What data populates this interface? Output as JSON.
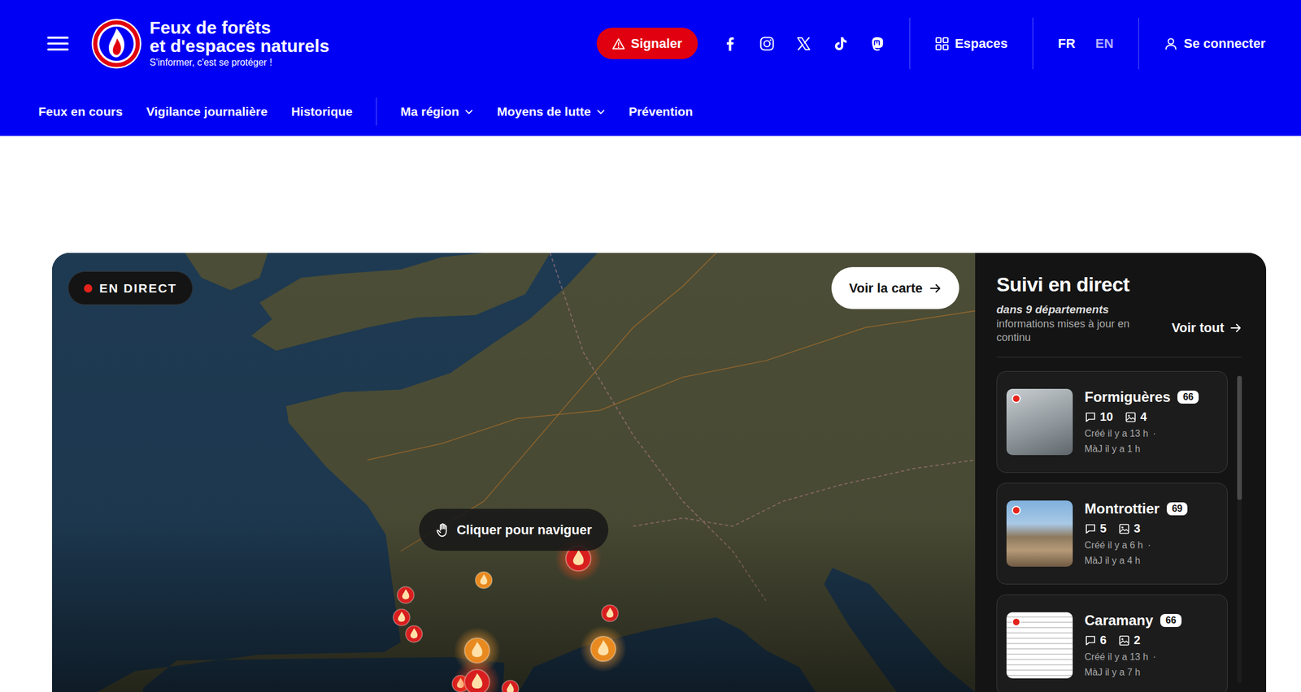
{
  "header": {
    "title_line_1": "Feux de forêts",
    "title_line_2": "et d'espaces naturels",
    "tagline": "S'informer, c'est se protéger !",
    "report_button": "Signaler",
    "spaces": "Espaces",
    "languages": [
      {
        "label": "FR",
        "selected": true
      },
      {
        "label": "EN",
        "selected": false
      }
    ],
    "login": "Se connecter"
  },
  "nav_groups": [
    [
      {
        "label": "Feux en cours",
        "dropdown": false
      },
      {
        "label": "Vigilance journalière",
        "dropdown": false
      },
      {
        "label": "Historique",
        "dropdown": false
      }
    ],
    [
      {
        "label": "Ma région",
        "dropdown": true
      },
      {
        "label": "Moyens de lutte",
        "dropdown": true
      },
      {
        "label": "Prévention",
        "dropdown": false
      }
    ]
  ],
  "map": {
    "live_badge": "EN DIRECT",
    "view_map": "Voir la carte",
    "navigate_hint": "Cliquer pour naviguer",
    "markers": [
      {
        "kind": "large",
        "color": "#d81e1e"
      },
      {
        "kind": "small",
        "color": "#e88a1f"
      },
      {
        "kind": "small",
        "color": "#d81e1e"
      },
      {
        "kind": "small",
        "color": "#d81e1e"
      },
      {
        "kind": "small",
        "color": "#d81e1e"
      },
      {
        "kind": "large",
        "color": "#e88a1f"
      },
      {
        "kind": "small",
        "color": "#d81e1e"
      },
      {
        "kind": "large",
        "color": "#e88a1f"
      },
      {
        "kind": "small",
        "color": "#d81e1e"
      },
      {
        "kind": "large",
        "color": "#d81e1e"
      },
      {
        "kind": "small",
        "color": "#d81e1e"
      }
    ]
  },
  "live_panel": {
    "title": "Suivi en direct",
    "subtitle": "dans 9 départements",
    "note": "informations mises à jour en continu",
    "see_all": "Voir tout",
    "meta_separator": "·",
    "fires": [
      {
        "name": "Formiguères",
        "department": "66",
        "comments": "10",
        "photos": "4",
        "created": "Créé il y a 13 h",
        "updated": "MàJ il y a 1 h",
        "live": true
      },
      {
        "name": "Montrottier",
        "department": "69",
        "comments": "5",
        "photos": "3",
        "created": "Créé il y a 6 h",
        "updated": "MàJ il y a 4 h",
        "live": true
      },
      {
        "name": "Caramany",
        "department": "66",
        "comments": "6",
        "photos": "2",
        "created": "Créé il y a 13 h",
        "updated": "MàJ il y a 7 h",
        "live": true
      }
    ]
  }
}
